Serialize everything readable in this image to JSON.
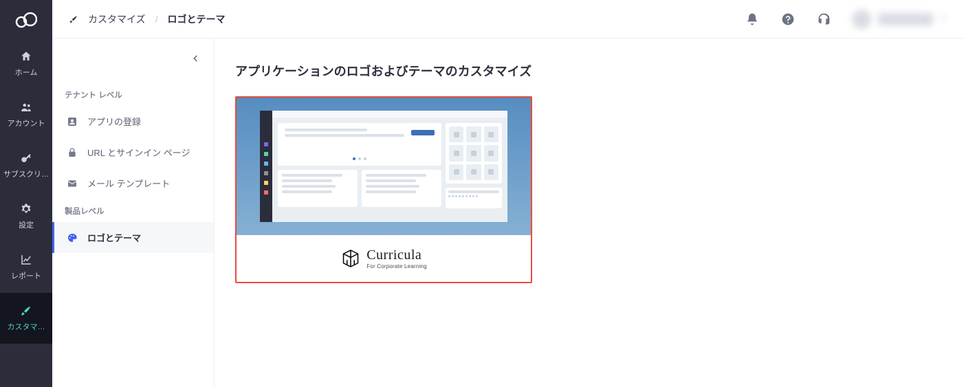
{
  "rail": {
    "items": [
      {
        "key": "home",
        "label": "ホーム"
      },
      {
        "key": "account",
        "label": "アカウント"
      },
      {
        "key": "subscribe",
        "label": "サブスクリ…"
      },
      {
        "key": "settings",
        "label": "設定"
      },
      {
        "key": "report",
        "label": "レポート"
      },
      {
        "key": "customize",
        "label": "カスタマ…"
      }
    ],
    "active": "customize"
  },
  "breadcrumb": {
    "root": "カスタマイズ",
    "separator": "/",
    "current": "ロゴとテーマ"
  },
  "panel": {
    "section1_label": "テナント レベル",
    "section2_label": "製品レベル",
    "items1": [
      {
        "key": "app-reg",
        "label": "アプリの登録"
      },
      {
        "key": "url-sign",
        "label": "URL とサインイン ページ"
      },
      {
        "key": "mail",
        "label": "メール テンプレート"
      }
    ],
    "items2": [
      {
        "key": "logo-theme",
        "label": "ロゴとテーマ"
      }
    ],
    "selected": "logo-theme"
  },
  "page": {
    "title": "アプリケーションのロゴおよびテーマのカスタマイズ"
  },
  "preview": {
    "brand_name": "Curricula",
    "brand_tagline": "For Corporate Learning"
  }
}
